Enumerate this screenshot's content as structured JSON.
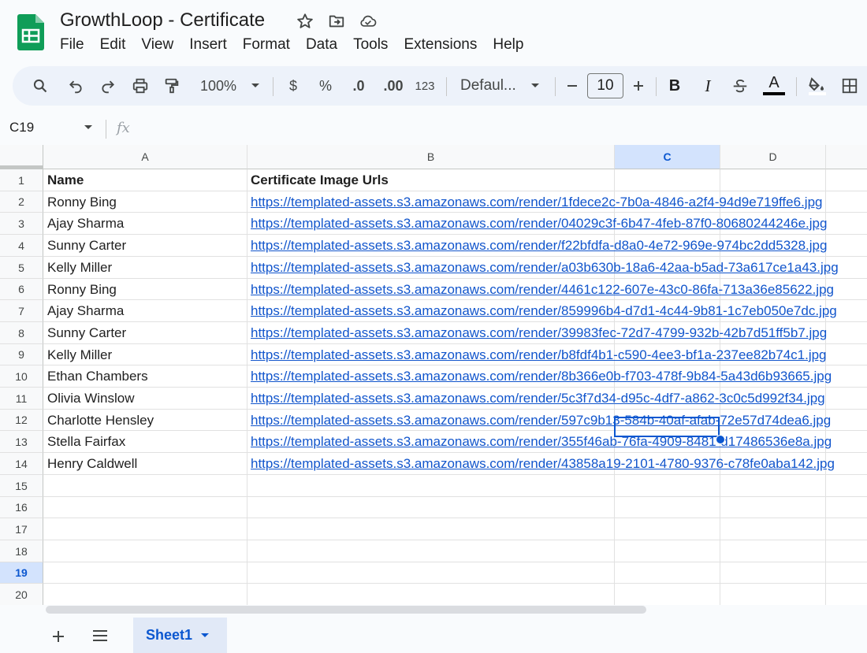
{
  "doc": {
    "title": "GrowthLoop - Certificate"
  },
  "menu": [
    "File",
    "Edit",
    "View",
    "Insert",
    "Format",
    "Data",
    "Tools",
    "Extensions",
    "Help"
  ],
  "toolbar": {
    "zoom": "100%",
    "currency": "$",
    "percent": "%",
    "decrease_decimal": ".0",
    "increase_decimal": ".00",
    "number_format": "123",
    "font": "Defaul...",
    "font_size": "10",
    "bold": "B",
    "italic": "I",
    "text_color_letter": "A"
  },
  "formula_bar": {
    "cell_ref": "C19",
    "fx": "fx"
  },
  "columns": [
    "A",
    "B",
    "C",
    "D"
  ],
  "selected_column": "C",
  "rows": [
    "1",
    "2",
    "3",
    "4",
    "5",
    "6",
    "7",
    "8",
    "9",
    "10",
    "11",
    "12",
    "13",
    "14",
    "15",
    "16",
    "17",
    "18",
    "19",
    "20"
  ],
  "selected_row": "19",
  "sheet": {
    "header": {
      "name": "Name",
      "url": "Certificate Image Urls"
    },
    "entries": [
      {
        "name": "Ronny Bing",
        "url": "https://templated-assets.s3.amazonaws.com/render/1fdece2c-7b0a-4846-a2f4-94d9e719ffe6.jpg"
      },
      {
        "name": "Ajay Sharma",
        "url": "https://templated-assets.s3.amazonaws.com/render/04029c3f-6b47-4feb-87f0-80680244246e.jpg"
      },
      {
        "name": "Sunny Carter",
        "url": "https://templated-assets.s3.amazonaws.com/render/f22bfdfa-d8a0-4e72-969e-974bc2dd5328.jpg"
      },
      {
        "name": "Kelly Miller",
        "url": "https://templated-assets.s3.amazonaws.com/render/a03b630b-18a6-42aa-b5ad-73a617ce1a43.jpg"
      },
      {
        "name": "Ronny Bing",
        "url": "https://templated-assets.s3.amazonaws.com/render/4461c122-607e-43c0-86fa-713a36e85622.jpg"
      },
      {
        "name": "Ajay Sharma",
        "url": "https://templated-assets.s3.amazonaws.com/render/859996b4-d7d1-4c44-9b81-1c7eb050e7dc.jpg"
      },
      {
        "name": "Sunny Carter",
        "url": "https://templated-assets.s3.amazonaws.com/render/39983fec-72d7-4799-932b-42b7d51ff5b7.jpg"
      },
      {
        "name": "Kelly Miller",
        "url": "https://templated-assets.s3.amazonaws.com/render/b8fdf4b1-c590-4ee3-bf1a-237ee82b74c1.jpg"
      },
      {
        "name": "Ethan Chambers",
        "url": "https://templated-assets.s3.amazonaws.com/render/8b366e0b-f703-478f-9b84-5a43d6b93665.jpg"
      },
      {
        "name": "Olivia Winslow",
        "url": "https://templated-assets.s3.amazonaws.com/render/5c3f7d34-d95c-4df7-a862-3c0c5d992f34.jpg"
      },
      {
        "name": "Charlotte Hensley",
        "url": "https://templated-assets.s3.amazonaws.com/render/597c9b13-584b-40af-afab-72e57d74dea6.jpg"
      },
      {
        "name": "Stella Fairfax",
        "url": "https://templated-assets.s3.amazonaws.com/render/355f46ab-76fa-4909-8481-d17486536e8a.jpg"
      },
      {
        "name": "Henry Caldwell",
        "url": "https://templated-assets.s3.amazonaws.com/render/43858a19-2101-4780-9376-c78fe0aba142.jpg"
      }
    ]
  },
  "tabs": [
    {
      "label": "Sheet1",
      "active": true
    }
  ],
  "colors": {
    "accent": "#0b57d0",
    "link": "#1155cc",
    "toolbar_bg": "#edf2fa",
    "selected_header_bg": "#d3e3fd",
    "logo_green": "#0f9d58"
  },
  "icons": [
    "sheets-logo-icon",
    "star-icon",
    "move-folder-icon",
    "cloud-saved-icon",
    "search-icon",
    "undo-icon",
    "redo-icon",
    "print-icon",
    "paint-format-icon",
    "dropdown-caret-icon",
    "minus-icon",
    "plus-icon",
    "strikethrough-icon",
    "fill-color-icon",
    "borders-icon",
    "add-sheet-icon",
    "all-sheets-icon"
  ]
}
